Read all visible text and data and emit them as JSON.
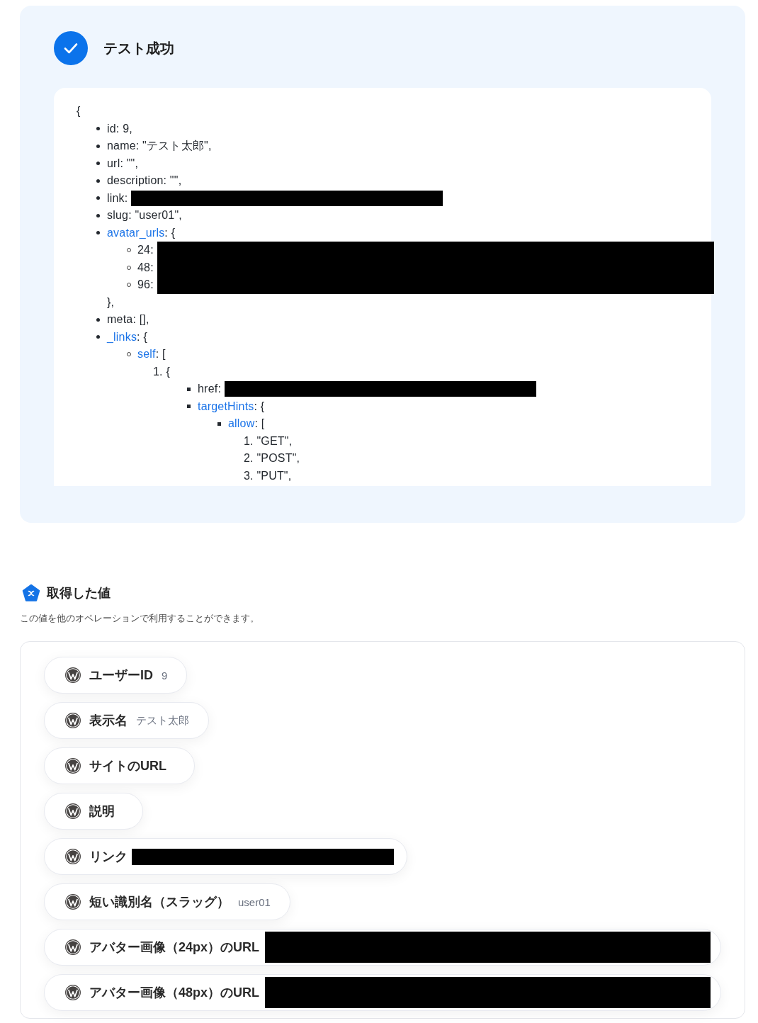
{
  "test_result": {
    "success": true,
    "title": "テスト成功"
  },
  "response": {
    "open": "{",
    "list": {
      "kind": "bullet",
      "items": [
        {
          "key": "id",
          "expandable": false,
          "redacted": false,
          "text": ": 9,"
        },
        {
          "key": "name",
          "expandable": false,
          "redacted": false,
          "text": ": \"テスト太郎\","
        },
        {
          "key": "url",
          "expandable": false,
          "redacted": false,
          "text": ": \"\","
        },
        {
          "key": "description",
          "expandable": false,
          "redacted": false,
          "text": ": \"\","
        },
        {
          "key": "link",
          "expandable": false,
          "redacted": true,
          "wide": false,
          "text": ":"
        },
        {
          "key": "slug",
          "expandable": false,
          "redacted": false,
          "text": ": \"user01\","
        },
        {
          "key": "avatar_urls",
          "expandable": true,
          "redacted": false,
          "text": ": {",
          "list": {
            "kind": "bullet",
            "items": [
              {
                "key": "24",
                "expandable": false,
                "redacted": true,
                "wide": true,
                "text": ":"
              },
              {
                "key": "48",
                "expandable": false,
                "redacted": true,
                "wide": true,
                "text": ":"
              },
              {
                "key": "96",
                "expandable": false,
                "redacted": true,
                "wide": true,
                "text": ":"
              }
            ]
          },
          "close": "},"
        },
        {
          "key": "meta",
          "expandable": false,
          "redacted": false,
          "text": ": [],"
        },
        {
          "key": "_links",
          "expandable": true,
          "redacted": false,
          "text": ": {",
          "list": {
            "kind": "bullet",
            "items": [
              {
                "key": "self",
                "expandable": true,
                "text": ": [",
                "list": {
                  "kind": "numbered",
                  "items": [
                    {
                      "number": "1.",
                      "text": "{",
                      "list": {
                        "kind": "bullet",
                        "items": [
                          {
                            "key": "href",
                            "expandable": false,
                            "redacted": true,
                            "wide": false,
                            "text": ":"
                          },
                          {
                            "key": "targetHints",
                            "expandable": true,
                            "redacted": false,
                            "text": ": {",
                            "list": {
                              "kind": "bullet",
                              "items": [
                                {
                                  "key": "allow",
                                  "expandable": true,
                                  "text": ": [",
                                  "list": {
                                    "kind": "numbered",
                                    "items": [
                                      {
                                        "number": "1.",
                                        "text": "\"GET\","
                                      },
                                      {
                                        "number": "2.",
                                        "text": "\"POST\","
                                      },
                                      {
                                        "number": "3.",
                                        "text": "\"PUT\","
                                      }
                                    ]
                                  }
                                }
                              ]
                            }
                          }
                        ]
                      }
                    }
                  ]
                }
              }
            ]
          }
        }
      ]
    }
  },
  "fetched_values": {
    "title": "取得した値",
    "description": "この値を他のオペレーションで利用することができます。",
    "items": [
      {
        "label": "ユーザーID",
        "value": "9",
        "redacted": false
      },
      {
        "label": "表示名",
        "value": "テスト太郎",
        "redacted": false
      },
      {
        "label": "サイトのURL",
        "redacted": false
      },
      {
        "label": "説明",
        "redacted": false
      },
      {
        "label": "リンク",
        "redacted": true,
        "wide": false
      },
      {
        "label": "短い識別名（スラッグ）",
        "value": "user01",
        "redacted": false
      },
      {
        "label": "アバター画像（24px）のURL",
        "redacted": true,
        "wide": true
      },
      {
        "label": "アバター画像（48px）のURL",
        "redacted": true,
        "wide": true
      }
    ]
  }
}
